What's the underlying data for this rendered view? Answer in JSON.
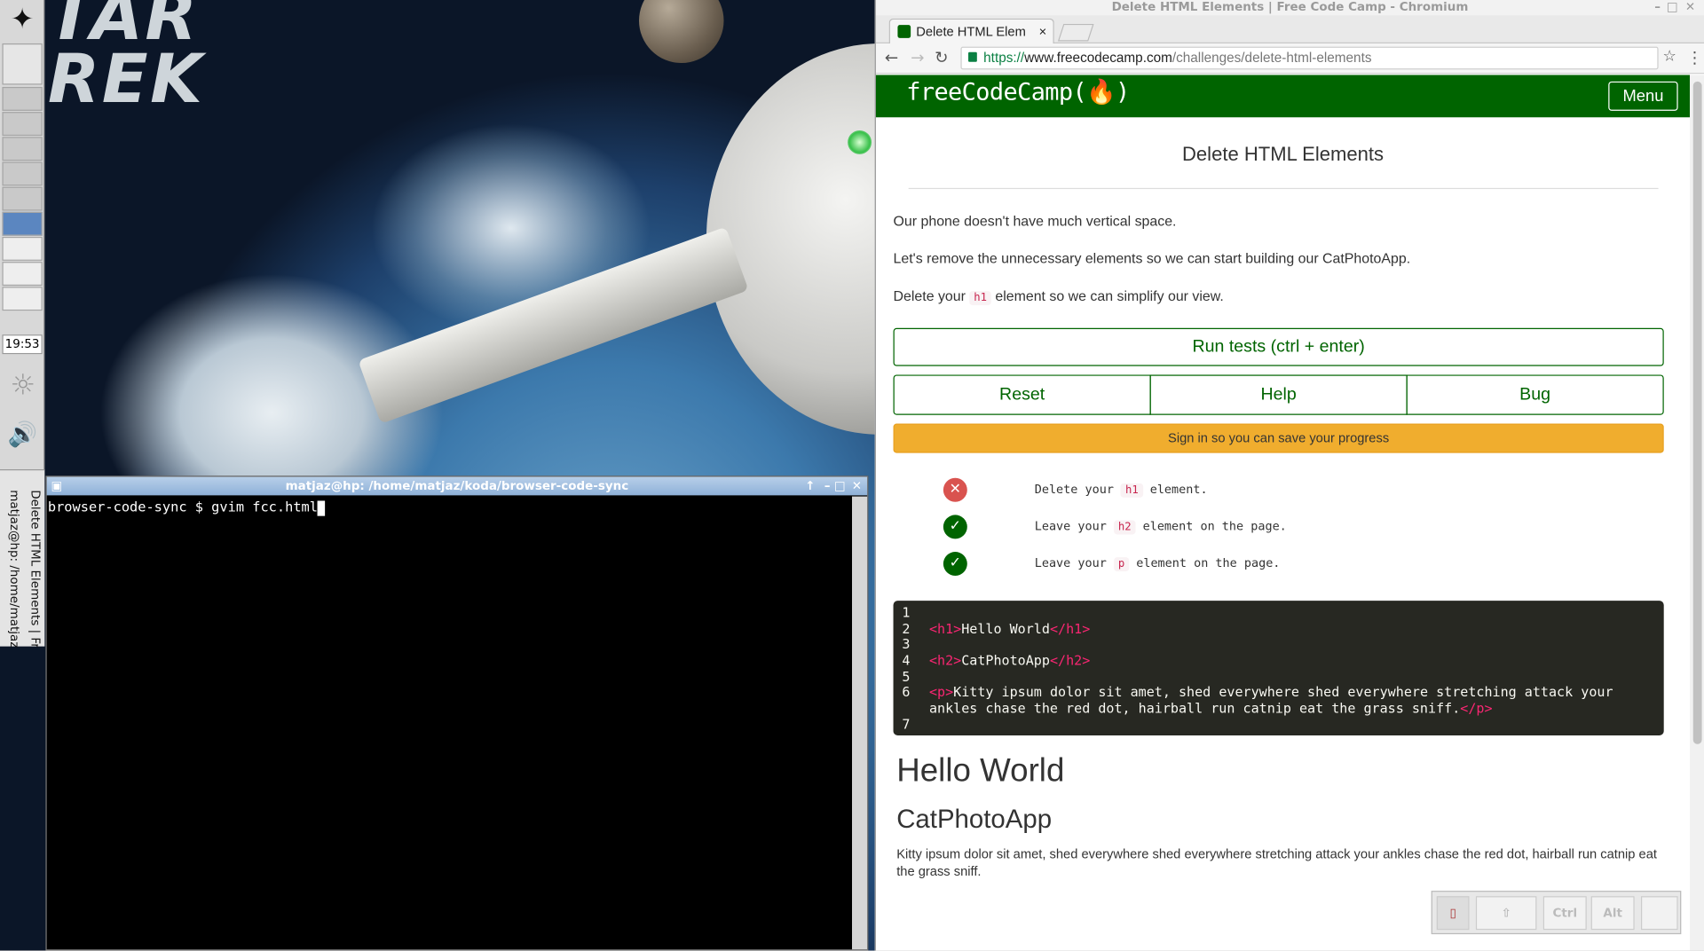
{
  "desktop": {
    "logo_text": "TAR\nREK",
    "clock": "19:53",
    "taskbar": [
      "matjaz@hp: /home/matjaz",
      "Delete HTML Elements | Fr"
    ]
  },
  "terminal": {
    "title": "matjaz@hp: /home/matjaz/koda/browser-code-sync",
    "prompt": "browser-code-sync $ gvim fcc.html"
  },
  "browser": {
    "window_title": "Delete HTML Elements | Free Code Camp - Chromium",
    "tab_title": "Delete HTML Elem",
    "url_scheme": "https://",
    "url_host": "www.freecodecamp.com",
    "url_path": "/challenges/delete-html-elements"
  },
  "fcc": {
    "logo": "freeCodeCamp(🔥)",
    "menu": "Menu"
  },
  "challenge": {
    "title": "Delete HTML Elements",
    "p1": "Our phone doesn't have much vertical space.",
    "p2": "Let's remove the unnecessary elements so we can start building our CatPhotoApp.",
    "p3_before": "Delete your ",
    "p3_code": "h1",
    "p3_after": " element so we can simplify our view.",
    "run": "Run tests (ctrl + enter)",
    "reset": "Reset",
    "help": "Help",
    "bug": "Bug",
    "signin": "Sign in so you can save your progress"
  },
  "tests": [
    {
      "pre": "Delete your ",
      "code": "h1",
      "post": " element.",
      "status": "fail"
    },
    {
      "pre": "Leave your ",
      "code": "h2",
      "post": " element on the page.",
      "status": "pass"
    },
    {
      "pre": "Leave your ",
      "code": "p",
      "post": " element on the page.",
      "status": "pass"
    }
  ],
  "editor": {
    "numbers": [
      "1",
      "2",
      "3",
      "4",
      "5",
      "6",
      "",
      "7"
    ],
    "l2_open": "<h1>",
    "l2_text": "Hello World",
    "l2_close": "</h1>",
    "l4_open": "<h2>",
    "l4_text": "CatPhotoApp",
    "l4_close": "</h2>",
    "l6_open": "<p>",
    "l6_text": "Kitty ipsum dolor sit amet, shed everywhere shed everywhere stretching attack your",
    "l6b_text": "ankles chase the red dot, hairball run catnip eat the grass sniff.",
    "l6_close": "</p>"
  },
  "preview": {
    "h1": "Hello World",
    "h2": "CatPhotoApp",
    "p": "Kitty ipsum dolor sit amet, shed everywhere shed everywhere stretching attack your ankles chase the red dot, hairball run catnip eat the grass sniff."
  },
  "osk": {
    "keys": [
      "Ctrl",
      "Alt"
    ]
  },
  "colors": {
    "fcc_green": "#006400",
    "signin_orange": "#f0ad2e",
    "fail_red": "#d9534f",
    "pass_green": "#006400",
    "editor_bg": "#272822",
    "tag_pink": "#f92672"
  }
}
